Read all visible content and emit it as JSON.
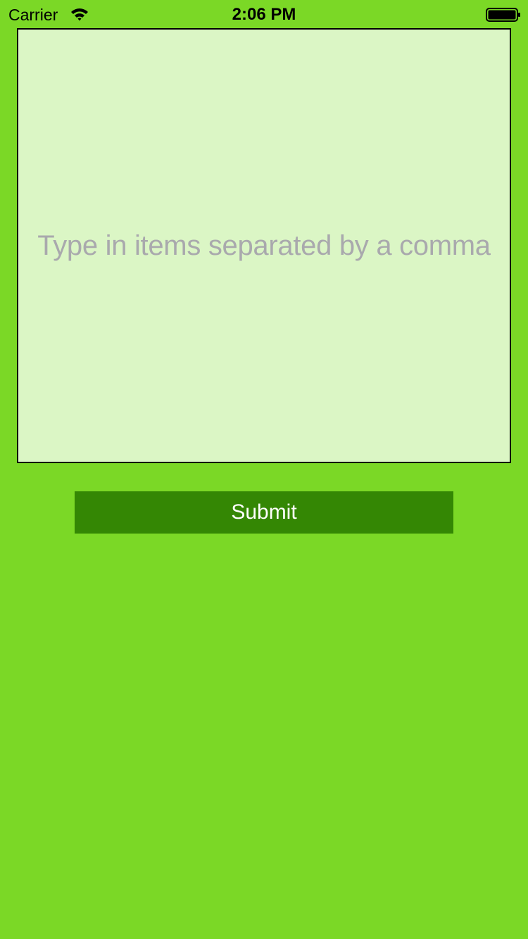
{
  "status_bar": {
    "carrier": "Carrier",
    "time": "2:06 PM",
    "wifi_icon": "wifi-icon",
    "battery_icon": "battery-icon"
  },
  "form": {
    "textarea_value": "",
    "textarea_placeholder": "Type in items separated by a comma",
    "submit_label": "Submit"
  },
  "colors": {
    "background": "#7bd826",
    "textarea_background": "#dbf6c5",
    "button_background": "#348704",
    "placeholder_text": "#a9a9ad"
  }
}
